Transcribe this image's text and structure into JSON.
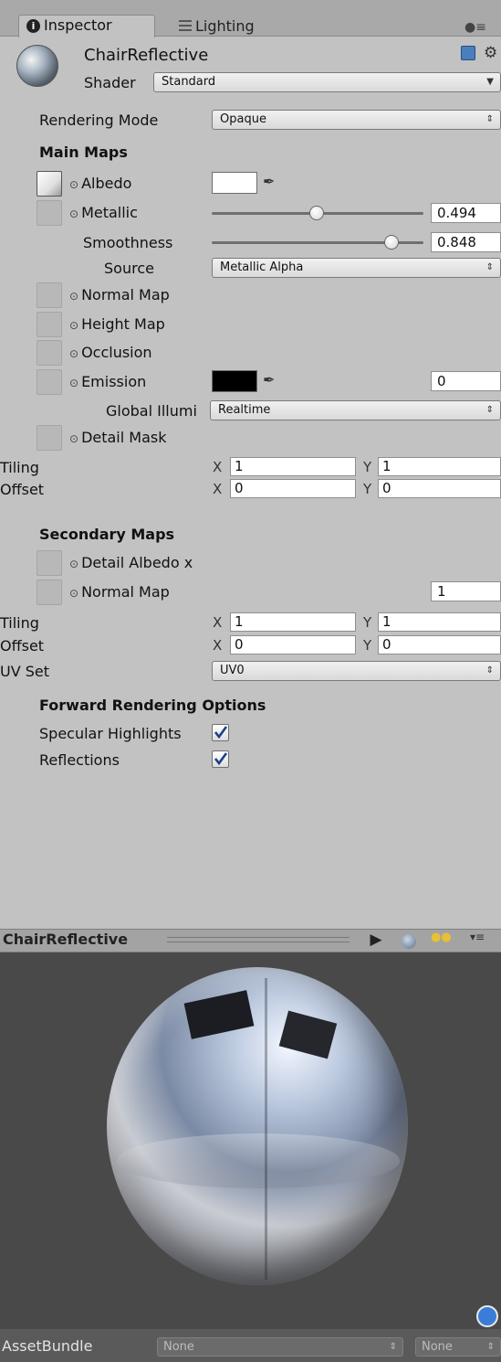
{
  "tabs": [
    {
      "label": "Inspector",
      "icon": "info-icon"
    },
    {
      "label": "Lighting",
      "icon": "lighting-grid-icon"
    }
  ],
  "material": {
    "name": "ChairReflective",
    "shader_label": "Shader",
    "shader_value": "Standard"
  },
  "rendering_mode": {
    "label": "Rendering Mode",
    "value": "Opaque"
  },
  "main_maps": {
    "heading": "Main Maps",
    "albedo": {
      "label": "Albedo",
      "color": "#ffffff"
    },
    "metallic": {
      "label": "Metallic",
      "value": "0.494",
      "fraction": 0.494
    },
    "smoothness": {
      "label": "Smoothness",
      "value": "0.848",
      "fraction": 0.848
    },
    "source": {
      "label": "Source",
      "value": "Metallic Alpha"
    },
    "normal_map": {
      "label": "Normal Map"
    },
    "height_map": {
      "label": "Height Map"
    },
    "occlusion": {
      "label": "Occlusion"
    },
    "emission": {
      "label": "Emission",
      "color": "#000000",
      "value": "0"
    },
    "global_illumination": {
      "label": "Global Illumi",
      "value": "Realtime"
    },
    "detail_mask": {
      "label": "Detail Mask"
    },
    "tiling": {
      "label": "Tiling",
      "x_label": "X",
      "y_label": "Y",
      "x": "1",
      "y": "1"
    },
    "offset": {
      "label": "Offset",
      "x_label": "X",
      "y_label": "Y",
      "x": "0",
      "y": "0"
    }
  },
  "secondary_maps": {
    "heading": "Secondary Maps",
    "detail_albedo": {
      "label": "Detail Albedo x"
    },
    "normal_map": {
      "label": "Normal Map",
      "value": "1"
    },
    "tiling": {
      "label": "Tiling",
      "x_label": "X",
      "y_label": "Y",
      "x": "1",
      "y": "1"
    },
    "offset": {
      "label": "Offset",
      "x_label": "X",
      "y_label": "Y",
      "x": "0",
      "y": "0"
    },
    "uv_set": {
      "label": "UV Set",
      "value": "UV0"
    }
  },
  "forward_rendering": {
    "heading": "Forward Rendering Options",
    "specular_highlights": {
      "label": "Specular Highlights",
      "checked": true
    },
    "reflections": {
      "label": "Reflections",
      "checked": true
    }
  },
  "preview": {
    "title": "ChairReflective"
  },
  "asset_bundle": {
    "label": "AssetBundle",
    "name_value": "None",
    "variant_value": "None"
  },
  "colors": {
    "accent": "#3a7dd8",
    "panel": "#c2c2c2",
    "preview_bg": "#494949"
  }
}
